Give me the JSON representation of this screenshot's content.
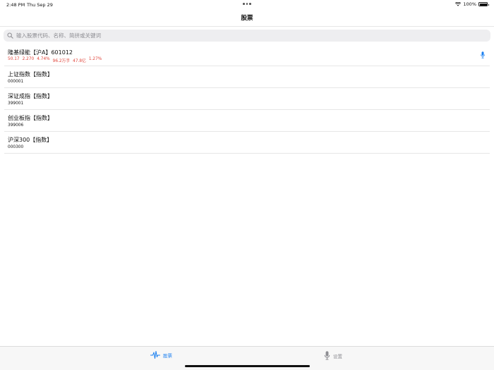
{
  "status_bar": {
    "time": "2:48 PM",
    "date": "Thu Sep 29",
    "battery": "100%"
  },
  "nav": {
    "title": "股票"
  },
  "search": {
    "placeholder": "输入股票代码、名称、简拼或关键词"
  },
  "stocks": [
    {
      "name": "隆基绿能【沪A】601012",
      "quote": [
        "50.17",
        "2.270",
        "4.74%",
        "96.2万手",
        "47.8亿",
        "1.27%"
      ]
    },
    {
      "name": "上证指数【指数】",
      "code": "000001"
    },
    {
      "name": "深证成指【指数】",
      "code": "399001"
    },
    {
      "name": "创业板指【指数】",
      "code": "399006"
    },
    {
      "name": "沪深300【指数】",
      "code": "000300"
    }
  ],
  "tabs": [
    {
      "label": "股票",
      "icon": "waveform-icon",
      "active": true
    },
    {
      "label": "设置",
      "icon": "mic-icon",
      "active": false
    }
  ],
  "colors": {
    "accent": "#1a7ff0",
    "down_red": "#e0443a",
    "inactive": "#8e8e93"
  }
}
